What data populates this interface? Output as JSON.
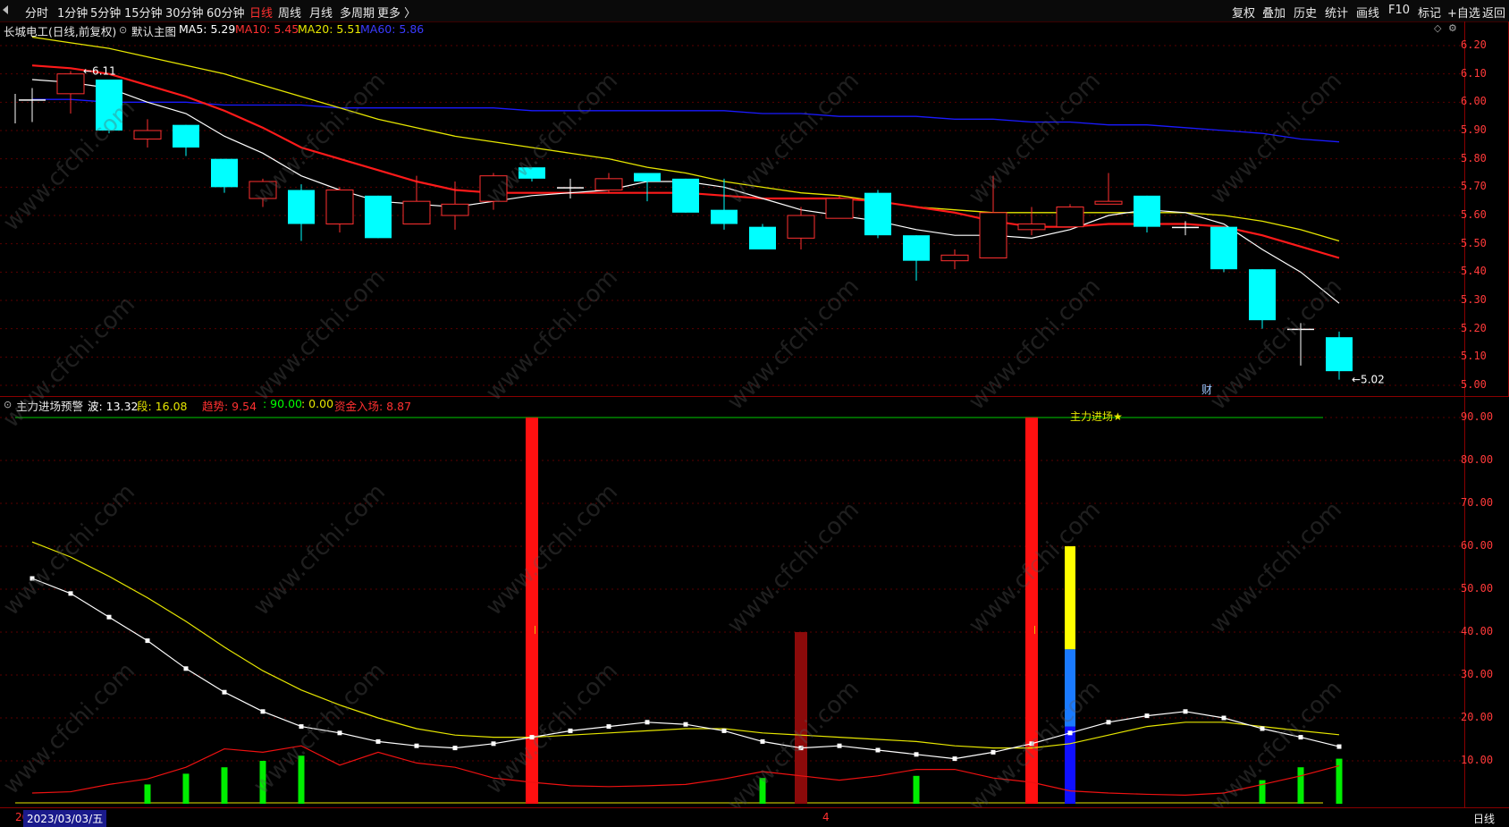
{
  "toolbar": {
    "periods": [
      "分时",
      "1分钟",
      "5分钟",
      "15分钟",
      "30分钟",
      "60分钟",
      "日线",
      "周线",
      "月线",
      "多周期",
      "更多 〉"
    ],
    "active_period": "日线",
    "right_buttons": [
      "复权",
      "叠加",
      "历史",
      "统计",
      "画线",
      "F10",
      "标记",
      "+自选",
      "返回"
    ]
  },
  "main_chart": {
    "title": "长城电工(日线,前复权)",
    "indicator_name": "默认主图",
    "ma5_label": "MA5: 5.29",
    "ma10_label": "MA10: 5.45",
    "ma20_label": "MA20: 5.51",
    "ma60_label": "MA60: 5.86",
    "high_marker": "6.11",
    "low_marker": "5.02",
    "news_badge": "财",
    "y_ticks": [
      "6.20",
      "6.10",
      "6.00",
      "5.90",
      "5.80",
      "5.70",
      "5.60",
      "5.50",
      "5.40",
      "5.30",
      "5.20",
      "5.10",
      "5.00"
    ],
    "colors": {
      "up": "#ff3030",
      "down": "#00ffff",
      "ma5": "#ffffff",
      "ma10": "#ff1a1a",
      "ma20": "#e6e600",
      "ma60": "#1a1aff"
    }
  },
  "sub_chart": {
    "title": "主力进场预警",
    "wave_label": "波: 13.32",
    "segment_label": "段: 16.08",
    "trend_label": "趋势: 9.54",
    "level_label": ": 90.00",
    "zero_label": ": 0.00",
    "fund_label": "资金入场: 8.87",
    "signal_text": "主力进场★",
    "y_ticks": [
      "90.00",
      "80.00",
      "70.00",
      "60.00",
      "50.00",
      "40.00",
      "30.00",
      "20.00",
      "10.00"
    ]
  },
  "chart_data": {
    "type": "candlestick",
    "candles": [
      {
        "o": 6.01,
        "h": 6.05,
        "l": 5.93,
        "c": 6.01
      },
      {
        "o": 6.03,
        "h": 6.11,
        "l": 5.96,
        "c": 6.1
      },
      {
        "o": 6.08,
        "h": 6.08,
        "l": 5.89,
        "c": 5.9
      },
      {
        "o": 5.87,
        "h": 5.94,
        "l": 5.84,
        "c": 5.9
      },
      {
        "o": 5.92,
        "h": 5.92,
        "l": 5.81,
        "c": 5.84
      },
      {
        "o": 5.8,
        "h": 5.8,
        "l": 5.68,
        "c": 5.7
      },
      {
        "o": 5.66,
        "h": 5.73,
        "l": 5.63,
        "c": 5.72
      },
      {
        "o": 5.69,
        "h": 5.71,
        "l": 5.51,
        "c": 5.57
      },
      {
        "o": 5.57,
        "h": 5.7,
        "l": 5.54,
        "c": 5.69
      },
      {
        "o": 5.67,
        "h": 5.67,
        "l": 5.52,
        "c": 5.52
      },
      {
        "o": 5.57,
        "h": 5.74,
        "l": 5.57,
        "c": 5.65
      },
      {
        "o": 5.6,
        "h": 5.72,
        "l": 5.55,
        "c": 5.64
      },
      {
        "o": 5.65,
        "h": 5.75,
        "l": 5.62,
        "c": 5.74
      },
      {
        "o": 5.77,
        "h": 5.77,
        "l": 5.72,
        "c": 5.73
      },
      {
        "o": 5.7,
        "h": 5.73,
        "l": 5.66,
        "c": 5.7
      },
      {
        "o": 5.69,
        "h": 5.75,
        "l": 5.68,
        "c": 5.73
      },
      {
        "o": 5.75,
        "h": 5.75,
        "l": 5.65,
        "c": 5.72
      },
      {
        "o": 5.73,
        "h": 5.73,
        "l": 5.61,
        "c": 5.61
      },
      {
        "o": 5.62,
        "h": 5.73,
        "l": 5.55,
        "c": 5.57
      },
      {
        "o": 5.56,
        "h": 5.57,
        "l": 5.48,
        "c": 5.48
      },
      {
        "o": 5.52,
        "h": 5.63,
        "l": 5.48,
        "c": 5.6
      },
      {
        "o": 5.59,
        "h": 5.67,
        "l": 5.59,
        "c": 5.66
      },
      {
        "o": 5.68,
        "h": 5.69,
        "l": 5.52,
        "c": 5.53
      },
      {
        "o": 5.53,
        "h": 5.53,
        "l": 5.37,
        "c": 5.44
      },
      {
        "o": 5.44,
        "h": 5.48,
        "l": 5.41,
        "c": 5.46
      },
      {
        "o": 5.45,
        "h": 5.74,
        "l": 5.45,
        "c": 5.61
      },
      {
        "o": 5.55,
        "h": 5.63,
        "l": 5.53,
        "c": 5.57
      },
      {
        "o": 5.56,
        "h": 5.64,
        "l": 5.56,
        "c": 5.63
      },
      {
        "o": 5.64,
        "h": 5.75,
        "l": 5.64,
        "c": 5.65
      },
      {
        "o": 5.67,
        "h": 5.67,
        "l": 5.54,
        "c": 5.56
      },
      {
        "o": 5.56,
        "h": 5.58,
        "l": 5.53,
        "c": 5.56
      },
      {
        "o": 5.56,
        "h": 5.56,
        "l": 5.4,
        "c": 5.41
      },
      {
        "o": 5.41,
        "h": 5.41,
        "l": 5.2,
        "c": 5.23
      },
      {
        "o": 5.2,
        "h": 5.22,
        "l": 5.07,
        "c": 5.2
      },
      {
        "o": 5.17,
        "h": 5.19,
        "l": 5.02,
        "c": 5.05
      }
    ],
    "ma5": [
      6.08,
      6.07,
      6.05,
      6.0,
      5.96,
      5.88,
      5.82,
      5.74,
      5.69,
      5.65,
      5.64,
      5.63,
      5.65,
      5.67,
      5.68,
      5.69,
      5.72,
      5.72,
      5.7,
      5.66,
      5.62,
      5.6,
      5.58,
      5.55,
      5.53,
      5.53,
      5.52,
      5.55,
      5.6,
      5.62,
      5.61,
      5.57,
      5.48,
      5.4,
      5.29
    ],
    "ma10": [
      6.13,
      6.12,
      6.1,
      6.06,
      6.02,
      5.97,
      5.91,
      5.84,
      5.8,
      5.76,
      5.72,
      5.69,
      5.68,
      5.68,
      5.68,
      5.68,
      5.68,
      5.68,
      5.67,
      5.66,
      5.66,
      5.66,
      5.65,
      5.63,
      5.61,
      5.58,
      5.56,
      5.56,
      5.57,
      5.57,
      5.57,
      5.56,
      5.53,
      5.49,
      5.45
    ],
    "ma20": [
      6.23,
      6.21,
      6.19,
      6.16,
      6.13,
      6.1,
      6.06,
      6.02,
      5.98,
      5.94,
      5.91,
      5.88,
      5.86,
      5.84,
      5.82,
      5.8,
      5.77,
      5.75,
      5.72,
      5.7,
      5.68,
      5.67,
      5.65,
      5.63,
      5.62,
      5.61,
      5.61,
      5.61,
      5.61,
      5.61,
      5.61,
      5.6,
      5.58,
      5.55,
      5.51
    ],
    "ma60": [
      6.01,
      6.01,
      6.0,
      6.0,
      6.0,
      5.99,
      5.99,
      5.99,
      5.98,
      5.98,
      5.98,
      5.98,
      5.98,
      5.97,
      5.97,
      5.97,
      5.97,
      5.97,
      5.97,
      5.96,
      5.96,
      5.95,
      5.95,
      5.95,
      5.94,
      5.94,
      5.93,
      5.93,
      5.92,
      5.92,
      5.91,
      5.9,
      5.89,
      5.87,
      5.86
    ],
    "wave": [
      52.5,
      49,
      43.5,
      38,
      31.5,
      26,
      21.5,
      18,
      16.5,
      14.5,
      13.5,
      13,
      14,
      15.5,
      17,
      18,
      19,
      18.5,
      17,
      14.5,
      13,
      13.5,
      12.5,
      11.5,
      10.5,
      12,
      14,
      16.5,
      19,
      20.5,
      21.5,
      20,
      17.5,
      15.5,
      13.32
    ],
    "segment": [
      61,
      57.5,
      53,
      48,
      42.5,
      36.5,
      31,
      26.5,
      23,
      20,
      17.5,
      16,
      15.5,
      15.5,
      16,
      16.5,
      17,
      17.5,
      17.5,
      16.5,
      16,
      15.5,
      15,
      14.5,
      13.5,
      13,
      13,
      14,
      16,
      18,
      19,
      19,
      18,
      17,
      16.08
    ],
    "fund": [
      2.5,
      2.8,
      4.5,
      5.8,
      8.5,
      12.8,
      12,
      13.5,
      9,
      12,
      9.5,
      8.5,
      6,
      5,
      4.2,
      4,
      4.2,
      4.5,
      5.8,
      7.5,
      6.5,
      5.5,
      6.5,
      8,
      8,
      6,
      5,
      3,
      2.5,
      2.2,
      2,
      2.5,
      4.5,
      6.5,
      8.87
    ],
    "green_bars": {
      "3": 4.5,
      "4": 7,
      "5": 8.5,
      "6": 10,
      "7": 11.2,
      "19": 6,
      "23": 6.5,
      "32": 5.5,
      "33": 8.5,
      "34": 10.5
    },
    "red_signal_bars": [
      13,
      26
    ],
    "dark_red_bar": {
      "index": 20,
      "value": 40
    },
    "stacked_bar": {
      "index": 27,
      "segments": [
        {
          "from": 0,
          "to": 18,
          "color": "#1010ff"
        },
        {
          "from": 18,
          "to": 36,
          "color": "#1a7aff"
        },
        {
          "from": 36,
          "to": 60,
          "color": "#ffff00"
        }
      ]
    },
    "level_line": 90
  },
  "bottom": {
    "date": "2023/03/03/五",
    "left_year_stub": "20",
    "mid_marker": "4",
    "tab": "日线"
  },
  "watermark": "www.cfchi.com"
}
